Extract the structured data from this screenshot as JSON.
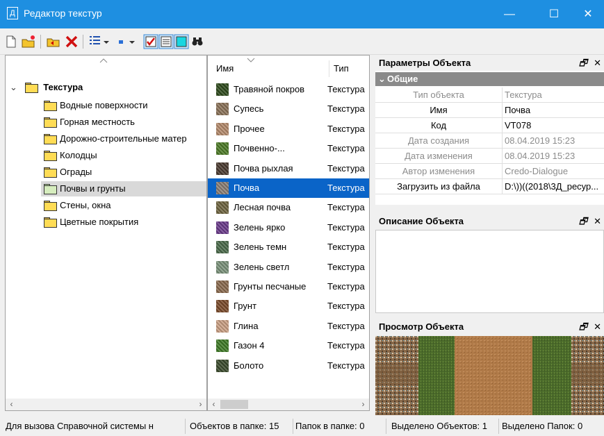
{
  "window": {
    "title": "Редактор текстур",
    "app_icon": "Д",
    "minimize": "—",
    "maximize": "☐",
    "close": "✕"
  },
  "toolbar": {
    "icons": [
      "new-file-icon",
      "new-folder-icon",
      "move-up-folder-icon",
      "delete-icon",
      "view-list-icon",
      "dropdown-arrow-icon",
      "small-icon-view-icon",
      "dropdown-arrow-icon",
      "checkbox-icon",
      "details-icon",
      "preview-icon",
      "binoculars-icon"
    ]
  },
  "tree": {
    "root": {
      "label": "Текстура",
      "expander": "⌄"
    },
    "items": [
      {
        "label": "Водные поверхности"
      },
      {
        "label": "Горная местность"
      },
      {
        "label": "Дорожно-строительные матер"
      },
      {
        "label": "Колодцы"
      },
      {
        "label": "Ограды"
      },
      {
        "label": "Почвы и грунты",
        "selected": true
      },
      {
        "label": "Стены, окна"
      },
      {
        "label": "Цветные покрытия"
      }
    ],
    "scroll_left": "‹",
    "scroll_right": "›"
  },
  "list": {
    "columns": {
      "name": "Имя",
      "type": "Тип"
    },
    "rows": [
      {
        "name": "Травяной покров",
        "type": "Текстура",
        "color": "#2e4a1c"
      },
      {
        "name": "Супесь",
        "type": "Текстура",
        "color": "#8a7258"
      },
      {
        "name": "Прочее",
        "type": "Текстура",
        "color": "#b48a6c"
      },
      {
        "name": "Почвенно-...",
        "type": "Текстура",
        "color": "#4c7a26"
      },
      {
        "name": "Почва рыхлая",
        "type": "Текстура",
        "color": "#4a3a30"
      },
      {
        "name": "Почва",
        "type": "Текстура",
        "color": "#8a7e74",
        "selected": true
      },
      {
        "name": "Лесная почва",
        "type": "Текстура",
        "color": "#6e6440"
      },
      {
        "name": "Зелень ярко",
        "type": "Текстура",
        "color": "#6a3a8a"
      },
      {
        "name": "Зелень темн",
        "type": "Текстура",
        "color": "#4a6a4a"
      },
      {
        "name": "Зелень светл",
        "type": "Текстура",
        "color": "#7a927a"
      },
      {
        "name": "Грунты песчаные",
        "type": "Текстура",
        "color": "#8a6a4e"
      },
      {
        "name": "Грунт",
        "type": "Текстура",
        "color": "#7a4a2a"
      },
      {
        "name": "Глина",
        "type": "Текстура",
        "color": "#caa084"
      },
      {
        "name": "Газон 4",
        "type": "Текстура",
        "color": "#3e7a26"
      },
      {
        "name": "Болото",
        "type": "Текстура",
        "color": "#3a4a2c"
      }
    ],
    "scroll_left": "‹",
    "scroll_right": "›"
  },
  "properties": {
    "title": "Параметры Объекта",
    "group": "Общие",
    "rows": [
      {
        "key": "Тип объекта",
        "value": "Текстура",
        "muted": true
      },
      {
        "key": "Имя",
        "value": "Почва",
        "muted": false
      },
      {
        "key": "Код",
        "value": "VT078",
        "muted": false
      },
      {
        "key": "Дата создания",
        "value": "08.04.2019 15:23",
        "muted": true
      },
      {
        "key": "Дата изменения",
        "value": "08.04.2019 15:23",
        "muted": true
      },
      {
        "key": "Автор изменения",
        "value": "Credo-Dialogue",
        "muted": true
      },
      {
        "key": "Загрузить из файла",
        "value": "D:\\))((2018\\3Д_ресур...",
        "muted": false
      }
    ]
  },
  "description": {
    "title": "Описание Объекта"
  },
  "preview": {
    "title": "Просмотр Объекта"
  },
  "panel_icons": {
    "pin": "🗗",
    "close": "✕"
  },
  "status": {
    "help": "Для вызова Справочной системы н",
    "objects_in_folder": "Объектов в папке: 15",
    "folders_in_folder": "Папок в папке: 0",
    "selected_objects": "Выделено Объектов: 1",
    "selected_folders": "Выделено Папок: 0"
  },
  "colors": {
    "titlebar": "#1e8fe1",
    "selection": "#0a64c8",
    "group_header": "#8a8a8a"
  }
}
